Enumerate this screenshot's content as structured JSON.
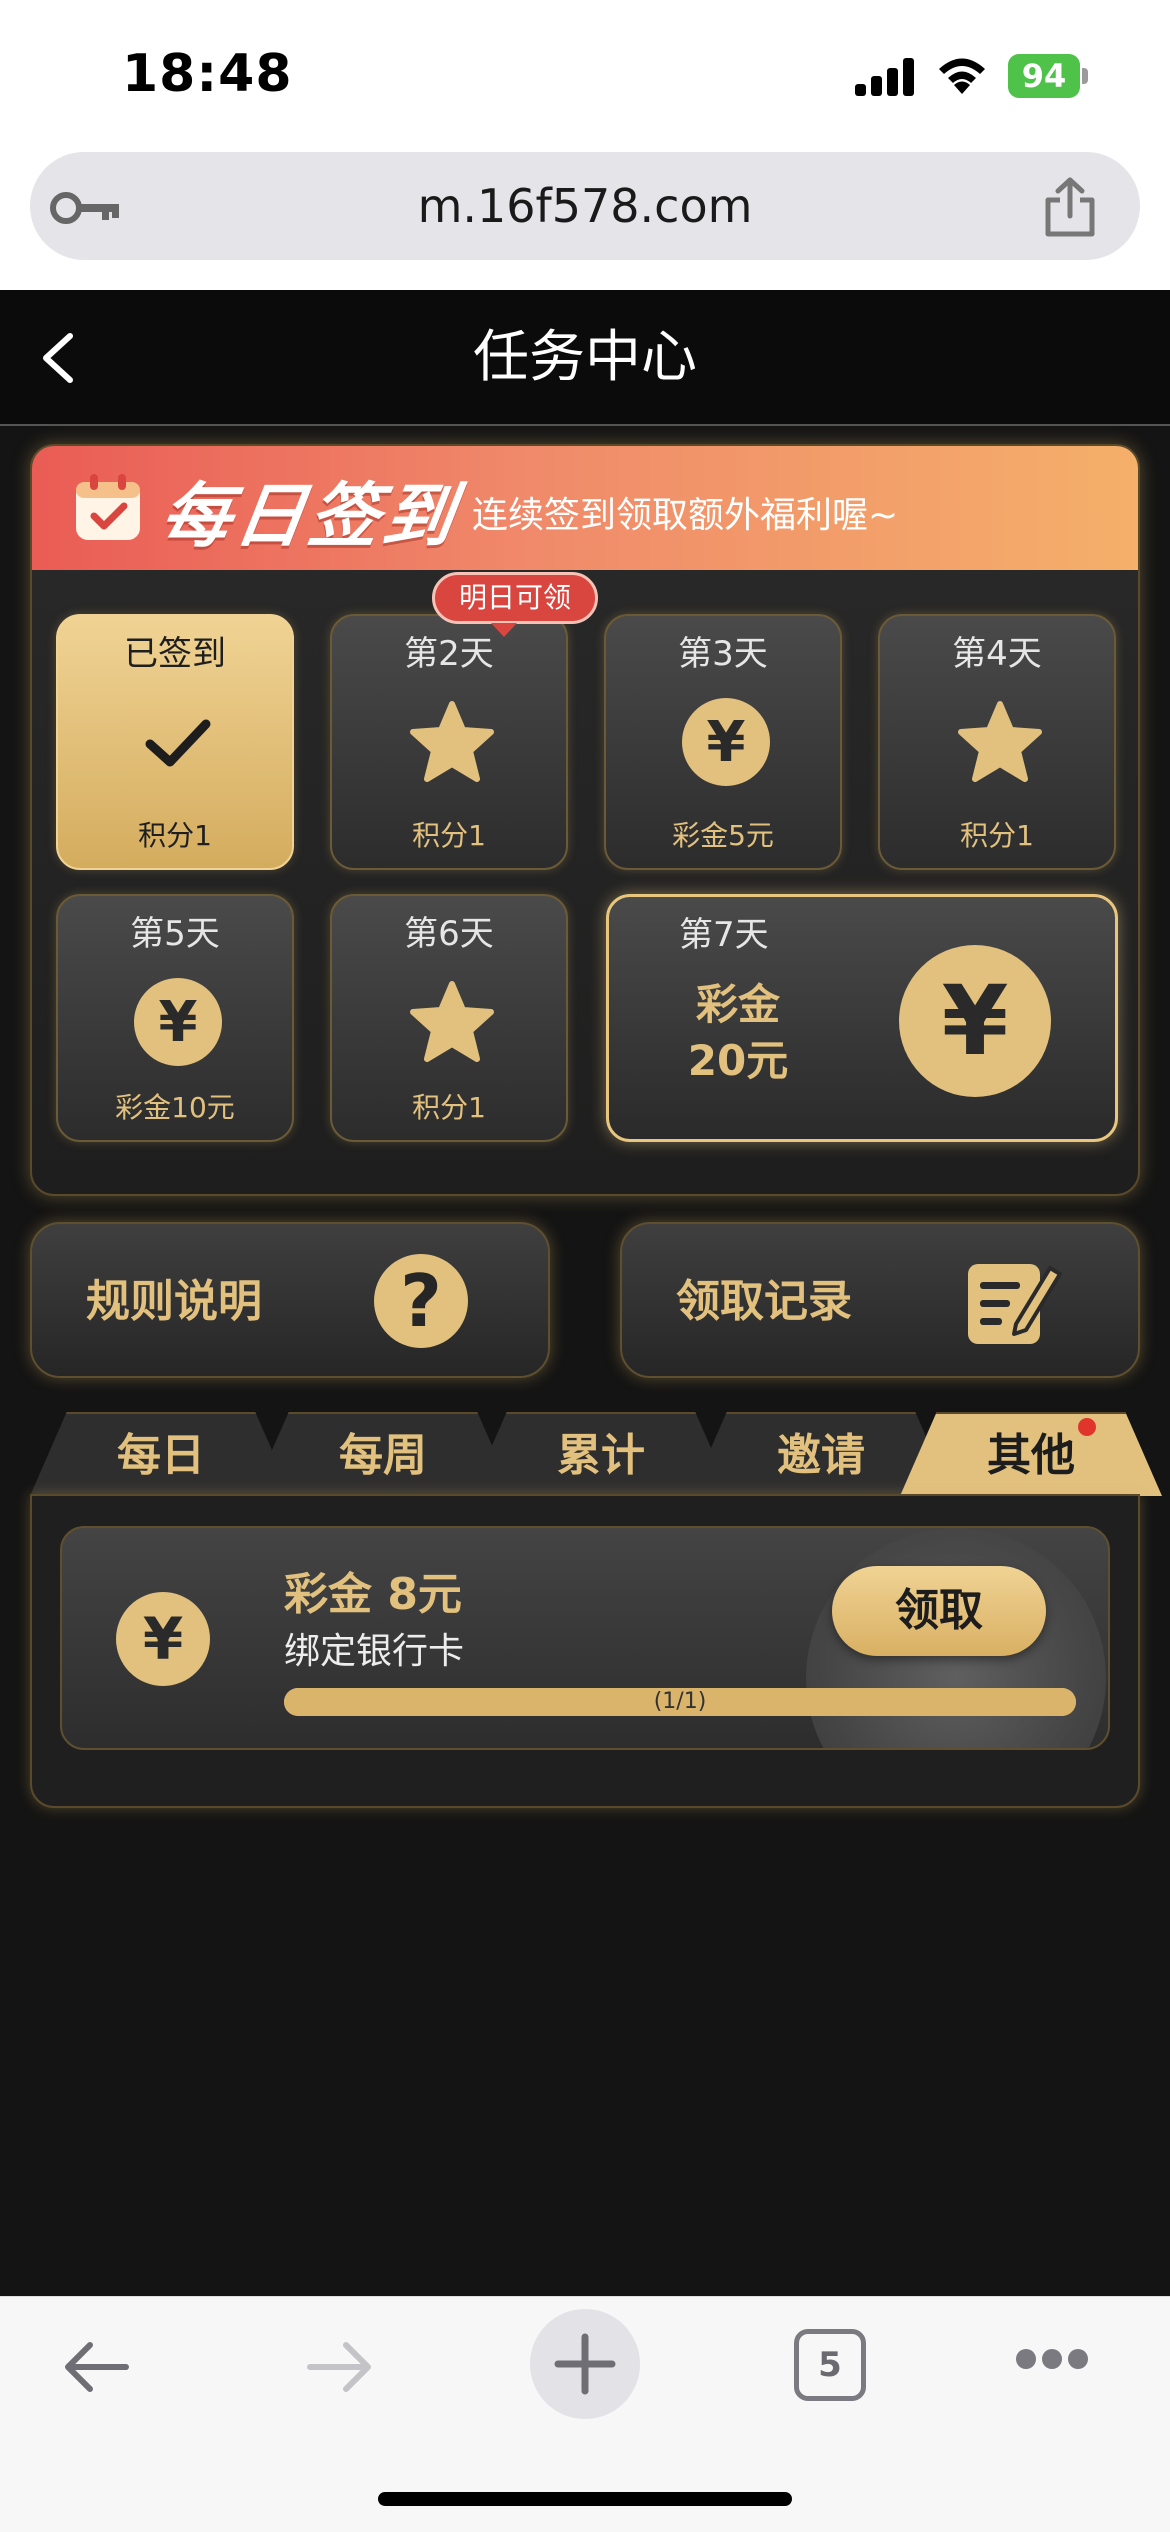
{
  "status": {
    "time": "18:48",
    "battery": "94"
  },
  "browser": {
    "url": "m.16f578.com",
    "tab_count": "5"
  },
  "header": {
    "title": "任务中心"
  },
  "signin": {
    "banner_title": "每日签到",
    "banner_subtitle": "连续签到领取额外福利喔~",
    "tomorrow_badge": "明日可领",
    "days": [
      {
        "label": "已签到",
        "reward": "积分1",
        "icon": "check-icon",
        "state": "signed"
      },
      {
        "label": "第2天",
        "reward": "积分1",
        "icon": "star-icon"
      },
      {
        "label": "第3天",
        "reward": "彩金5元",
        "icon": "yen-coin-icon"
      },
      {
        "label": "第4天",
        "reward": "积分1",
        "icon": "star-icon"
      },
      {
        "label": "第5天",
        "reward": "彩金10元",
        "icon": "yen-coin-icon"
      },
      {
        "label": "第6天",
        "reward": "积分1",
        "icon": "star-icon"
      }
    ],
    "day7": {
      "label": "第7天",
      "reward_line1": "彩金",
      "reward_line2": "20元",
      "icon": "yen-coin-icon"
    }
  },
  "actions": {
    "rules": "规则说明",
    "records": "领取记录"
  },
  "tabs": [
    {
      "label": "每日"
    },
    {
      "label": "每周"
    },
    {
      "label": "累计"
    },
    {
      "label": "邀请"
    },
    {
      "label": "其他",
      "active": true,
      "has_dot": true
    }
  ],
  "task": {
    "title": "彩金 8元",
    "desc": "绑定银行卡",
    "progress_text": "(1/1)",
    "progress": 1.0,
    "claim": "领取"
  },
  "symbols": {
    "yen": "¥",
    "question": "?",
    "plus": "+"
  },
  "colors": {
    "gold": "#e2c17f",
    "banner_start": "#ea5c55",
    "banner_end": "#f5b06a",
    "badge_red": "#d9453f",
    "background": "#141414"
  }
}
